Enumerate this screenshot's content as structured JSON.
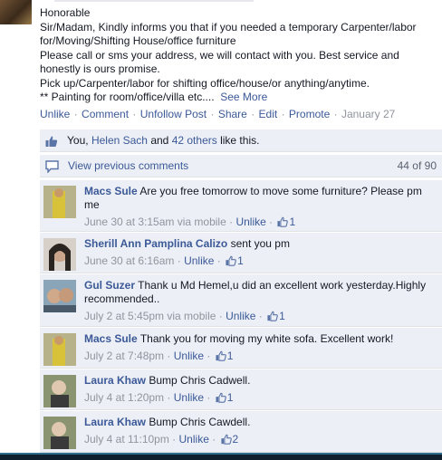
{
  "post": {
    "lines": [
      "Honorable",
      "Sir/Madam, Kindly informs you that if you needed a temporary Carpenter/labor",
      "for/Moving/Shifting House/office furniture",
      "Please call or sms your address, we will contact with you. Best service and",
      "honestly is ours promise.",
      "Pick up/Carpenter/labor for shifting office/house/or anything/anytime.",
      "** Painting for room/office/villa etc...."
    ],
    "see_more": "See More",
    "actions": {
      "unlike": "Unlike",
      "comment": "Comment",
      "unfollow": "Unfollow Post",
      "share": "Share",
      "edit": "Edit",
      "promote": "Promote",
      "date": "January 27",
      "separator": "·"
    }
  },
  "likes": {
    "you": "You,",
    "friend": "Helen Sach",
    "and": "and",
    "others": "42 others",
    "suffix": "like this."
  },
  "previous": {
    "label": "View previous comments",
    "count": "44 of 90"
  },
  "comments": [
    {
      "author": "Macs Sule",
      "text": "Are you free tomorrow to move some furniture? Please pm me",
      "time": "June 30 at 3:15am via mobile",
      "unlike": "Unlike",
      "likes": "1"
    },
    {
      "author": "Sherill Ann Pamplina Calizo",
      "text": "sent you pm",
      "time": "June 30 at 6:16am",
      "unlike": "Unlike",
      "likes": "1"
    },
    {
      "author": "Gul Suzer",
      "text": "Thank u Md Hemel,u did an excellent work yesterday.Highly recommended..",
      "time": "July 2 at 5:45pm via mobile",
      "unlike": "Unlike",
      "likes": "1"
    },
    {
      "author": "Macs Sule",
      "text": "Thank you for moving my white sofa. Excellent work!",
      "time": "July 2 at 7:48pm",
      "unlike": "Unlike",
      "likes": "1"
    },
    {
      "author": "Laura Khaw",
      "text": "Bump Chris Cadwell.",
      "time": "July 4 at 1:20pm",
      "unlike": "Unlike",
      "likes": "1"
    },
    {
      "author": "Laura Khaw",
      "text": "Bump Chris Cawdell.",
      "time": "July 4 at 11:10pm",
      "unlike": "Unlike",
      "likes": "2"
    }
  ],
  "colors": {
    "link": "#3b5998",
    "meta": "#90949c",
    "comment_bg": "#eceff5"
  }
}
